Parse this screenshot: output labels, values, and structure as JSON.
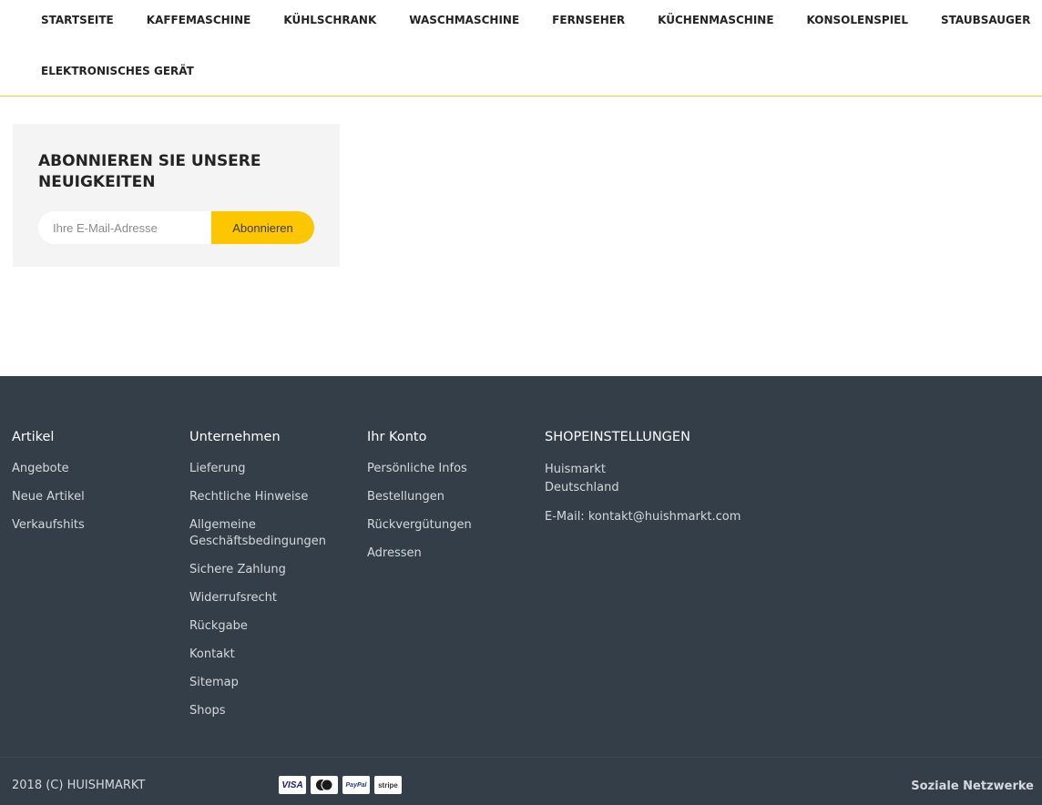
{
  "nav": {
    "row1": [
      "STARTSEITE",
      "KAFFEMASCHINE",
      "KÜHLSCHRANK",
      "WASCHMASCHINE",
      "FERNSEHER",
      "KÜCHENMASCHINE",
      "KONSOLENSPIEL",
      "STAUBSAUGER"
    ],
    "row2": [
      "ELEKTRONISCHES GERÄT"
    ]
  },
  "newsletter": {
    "title_line1": "ABONNIEREN SIE UNSERE",
    "title_line2": "NEUIGKEITEN",
    "email_placeholder": "Ihre E-Mail-Adresse",
    "email_value": "",
    "button_label": "Abonnieren"
  },
  "footer": {
    "artikel": {
      "heading": "Artikel",
      "links": [
        "Angebote",
        "Neue Artikel",
        "Verkaufshits"
      ]
    },
    "unternehmen": {
      "heading": "Unternehmen",
      "links": [
        "Lieferung",
        "Rechtliche Hinweise",
        "Allgemeine Geschäftsbedingungen",
        "Sichere Zahlung",
        "Widerrufsrecht",
        "Rückgabe",
        "Kontakt",
        "Sitemap",
        "Shops"
      ]
    },
    "konto": {
      "heading": "Ihr Konto",
      "links": [
        "Persönliche Infos",
        "Bestellungen",
        "Rückvergütungen",
        "Adressen"
      ]
    },
    "shop": {
      "heading": "SHOPEINSTELLUNGEN",
      "name": "Huismarkt",
      "country": "Deutschland",
      "email": "E-Mail: kontakt@huishmarkt.com"
    },
    "copyright": "2018 (C) HUISHMARKT",
    "payment": {
      "visa": "VISA",
      "mastercard": "mastercard",
      "paypal": "PayPal",
      "stripe": "stripe"
    },
    "social_label": "Soziale Netzwerke"
  },
  "colors": {
    "accent": "#fcc601",
    "footer_bg": "#333e48",
    "nav_border": "#e9cf3c"
  },
  "icons": [
    "visa-icon",
    "mastercard-icon",
    "paypal-icon",
    "stripe-icon"
  ]
}
